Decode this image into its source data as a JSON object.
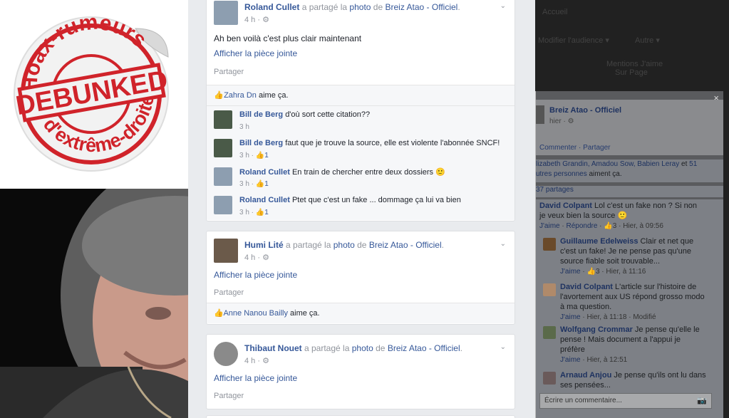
{
  "sticker": {
    "top_text": "Hoax-rumeurs",
    "main_text": "DEBUNKED",
    "bottom_text": "d'extrême-droite",
    "color": "#d0232a"
  },
  "feed": {
    "posts": [
      {
        "author": "Roland Cullet",
        "action": "a partagé la",
        "object": "photo",
        "prep": "de",
        "page": "Breiz Atao - Officiel",
        "time": "4 h ·",
        "text": "Ah ben voilà c'est plus clair maintenant",
        "attachment": "Afficher la pièce jointe",
        "share": "Partager",
        "likes_name": "Zahra Dn",
        "likes_suffix": "aime ça.",
        "comments": [
          {
            "author": "Bill de Berg",
            "text": "d'où sort cette citation??",
            "time": "3 h",
            "count": ""
          },
          {
            "author": "Bill de Berg",
            "text": "faut que je trouve la source, elle est violente l'abonnée SNCF!",
            "time": "3 h ·",
            "count": "1"
          },
          {
            "author": "Roland Cullet",
            "text": "En train de chercher entre deux dossiers 🙂",
            "time": "3 h ·",
            "count": "1"
          },
          {
            "author": "Roland Cullet",
            "text": "Ptet que c'est un fake ... dommage ça lui va bien",
            "time": "3 h ·",
            "count": "1"
          }
        ]
      },
      {
        "author": "Humi Lité",
        "action": "a partagé la",
        "object": "photo",
        "prep": "de",
        "page": "Breiz Atao - Officiel",
        "time": "4 h ·",
        "attachment": "Afficher la pièce jointe",
        "share": "Partager",
        "likes_name": "Anne Nanou Bailly",
        "likes_suffix": "aime ça."
      },
      {
        "author": "Thibaut Nouet",
        "action": "a partagé la",
        "object": "photo",
        "prep": "de",
        "page": "Breiz Atao - Officiel",
        "time": "4 h ·",
        "attachment": "Afficher la pièce jointe",
        "share": "Partager"
      }
    ]
  },
  "right": {
    "bg_items": [
      "Accueil",
      "Modifier l'audience ▾",
      "Autre ▾",
      "Mentions J'aime",
      "Sur Page"
    ],
    "close": "×",
    "page_name": "Breiz Atao - Officiel",
    "page_time": "hier ·",
    "comment_link": "Commenter",
    "share_link": "Partager",
    "likes_names": "lizabeth Grandin, Amadou Sow, Babien Leray",
    "likes_and": "et",
    "likes_count": "51",
    "likes_rest": "utres personnes",
    "likes_suffix": "aiment ça.",
    "shares": "37 partages",
    "comments": [
      {
        "author": "David Colpant",
        "text": "Lol c'est un fake non ? Si non je veux bien la source 🙂",
        "meta_like": "J'aime",
        "meta_reply": "Répondre",
        "count": "3",
        "time": "Hier, à 09:56",
        "indent": false
      },
      {
        "author": "Guillaume Edelweiss",
        "text": "Clair et net que c'est un fake! Je ne pense pas qu'une source fiable soit trouvable...",
        "meta_like": "J'aime",
        "count": "3",
        "time": "Hier, à 11:16",
        "indent": true
      },
      {
        "author": "David Colpant",
        "text": "L'article sur l'histoire de l'avortement aux US répond grosso modo à ma question.",
        "meta_like": "J'aime",
        "time": "Hier, à 11:18",
        "extra": "Modifié",
        "indent": true
      },
      {
        "author": "Wolfgang Crommar",
        "text": "Je pense qu'elle le pense ! Mais document a l'appui je préfère",
        "meta_like": "J'aime",
        "time": "Hier, à 12:51",
        "indent": true
      },
      {
        "author": "Arnaud Anjou",
        "text": "Je pense qu'ils ont lu dans ses pensées...",
        "indent": true
      }
    ],
    "write_placeholder": "Écrire un commentaire..."
  }
}
